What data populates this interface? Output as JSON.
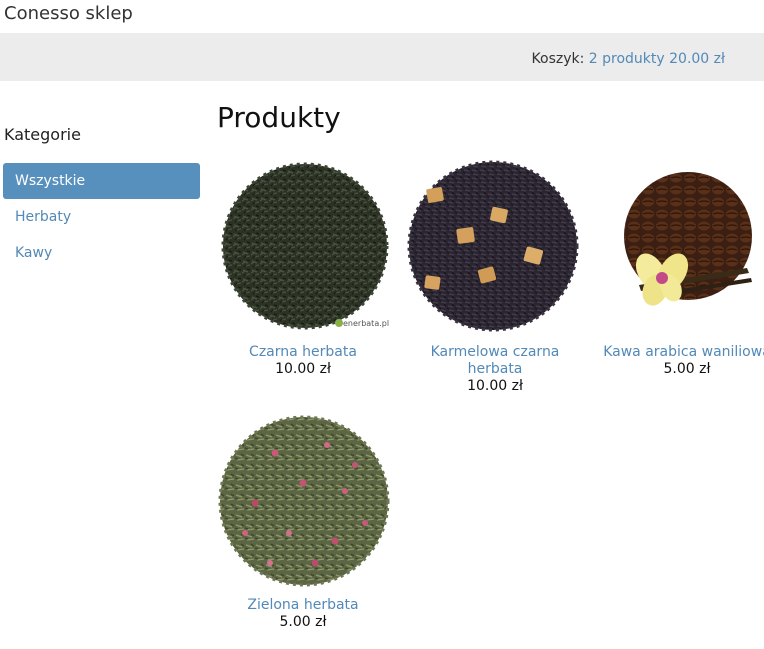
{
  "site": {
    "title": "Conesso sklep"
  },
  "cart": {
    "label": "Koszyk:",
    "summary": "2 produkty 20.00 zł"
  },
  "sidebar": {
    "heading": "Kategorie",
    "items": [
      {
        "label": "Wszystkie",
        "active": true
      },
      {
        "label": "Herbaty",
        "active": false
      },
      {
        "label": "Kawy",
        "active": false
      }
    ]
  },
  "main": {
    "heading": "Produkty"
  },
  "products": [
    {
      "name": "Czarna herbata",
      "price": "10.00 zł",
      "image": "black-tea-image",
      "watermark": "enerbata.pl"
    },
    {
      "name": "Karmelowa czarna herbata",
      "price": "10.00 zł",
      "image": "caramel-black-tea-image"
    },
    {
      "name": "Kawa arabica waniliowa",
      "price": "5.00 zł",
      "image": "vanilla-arabica-coffee-image"
    },
    {
      "name": "Zielona herbata",
      "price": "5.00 zł",
      "image": "green-tea-image"
    }
  ],
  "colors": {
    "link": "#5289b7",
    "active_bg": "#5790bd",
    "topbar_bg": "#ececec"
  }
}
